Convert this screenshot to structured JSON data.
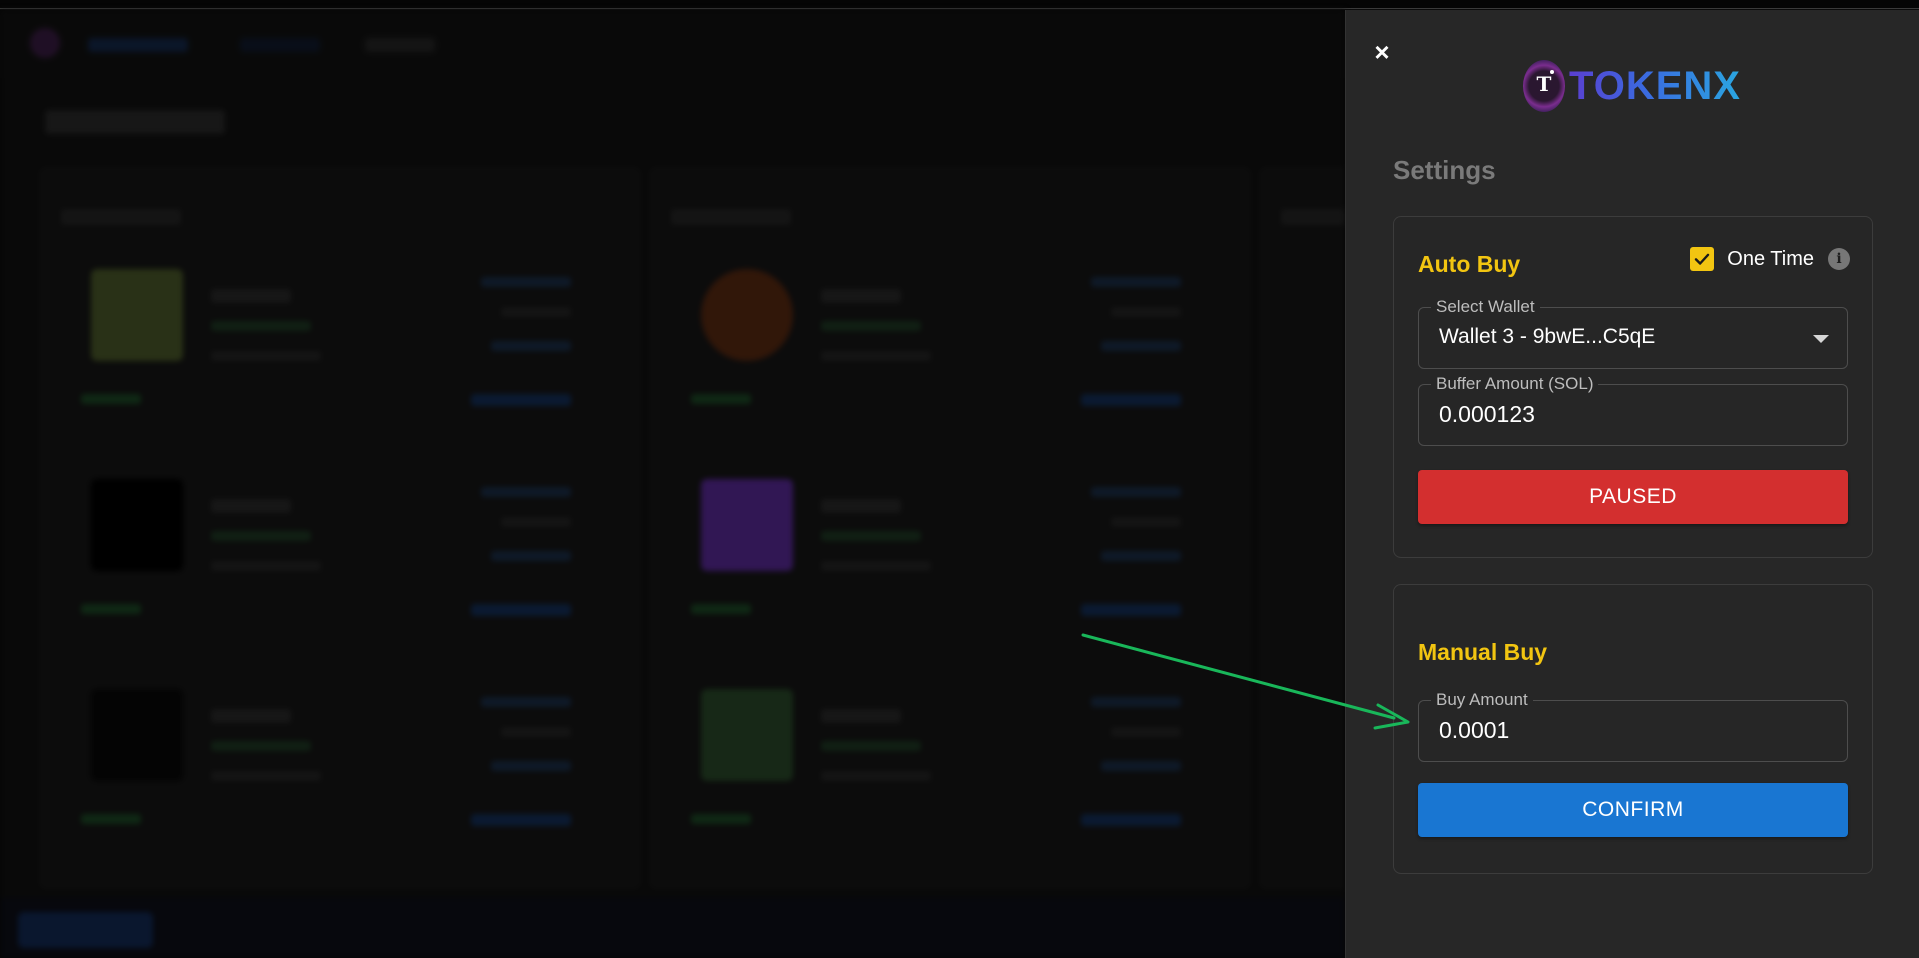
{
  "drawer": {
    "close_icon": "×",
    "brand": {
      "logo_letter": "T",
      "name": "TOKENX"
    },
    "settings_title": "Settings",
    "auto_buy": {
      "title": "Auto Buy",
      "one_time_label": "One Time",
      "one_time_checked": true,
      "info_icon": "i",
      "select_wallet_label": "Select Wallet",
      "select_wallet_value": "Wallet 3 - 9bwE...C5qE",
      "buffer_amount_label": "Buffer Amount (SOL)",
      "buffer_amount_value": "0.000123",
      "status_button": "PAUSED"
    },
    "manual_buy": {
      "title": "Manual Buy",
      "buy_amount_label": "Buy Amount",
      "buy_amount_value": "0.0001",
      "confirm_button": "CONFIRM"
    }
  },
  "colors": {
    "accent_yellow": "#f2c511",
    "paused_red": "#d32f2f",
    "confirm_blue": "#1976d2",
    "annotation_arrow": "#19b75a"
  }
}
